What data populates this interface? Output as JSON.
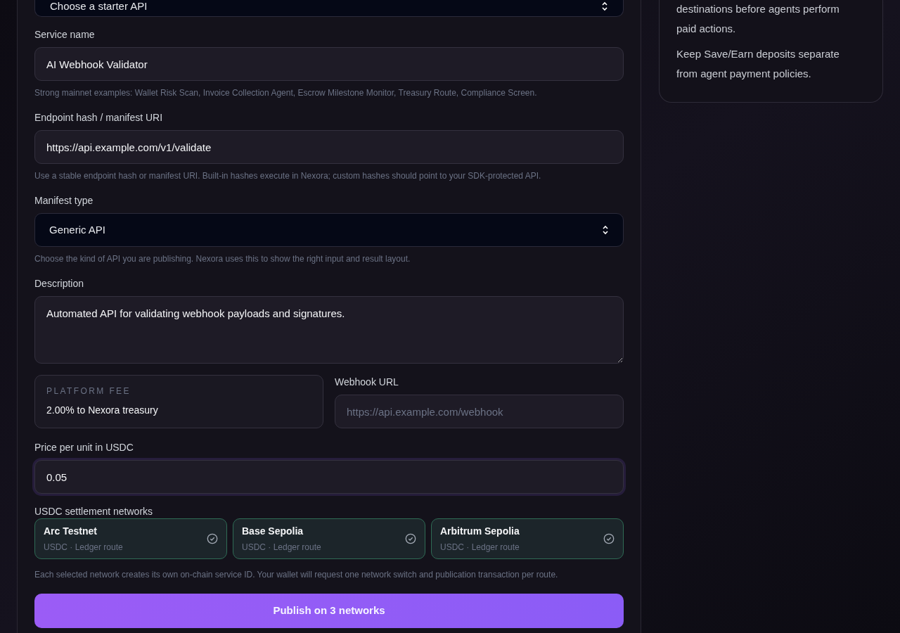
{
  "starter_select": {
    "value": "Choose a starter API"
  },
  "fields": [
    {
      "kind": "input",
      "label": "Service name",
      "value": "AI Webhook Validator",
      "hint": "Strong mainnet examples: Wallet Risk Scan, Invoice Collection Agent, Escrow Milestone Monitor, Treasury Route, Compliance Screen."
    },
    {
      "kind": "input",
      "label": "Endpoint hash / manifest URI",
      "value": "https://api.example.com/v1/validate",
      "hint": "Use a stable endpoint hash or manifest URI. Built-in hashes execute in Nexora; custom hashes should point to your SDK-protected API."
    },
    {
      "kind": "select",
      "label": "Manifest type",
      "value": "Generic API",
      "hint": "Choose the kind of API you are publishing. Nexora uses this to show the right input and result layout."
    },
    {
      "kind": "textarea",
      "label": "Description",
      "value": "Automated API for validating webhook payloads and signatures."
    }
  ],
  "platform_fee": {
    "label": "PLATFORM FEE",
    "value": "2.00% to Nexora treasury"
  },
  "webhook": {
    "label": "Webhook URL",
    "placeholder": "https://api.example.com/webhook"
  },
  "price": {
    "label": "Price per unit in USDC",
    "value": "0.05",
    "focused": true
  },
  "networks": {
    "label": "USDC settlement networks",
    "items": [
      {
        "name": "Arc Testnet",
        "detail": "USDC · Ledger route",
        "selected": true
      },
      {
        "name": "Base Sepolia",
        "detail": "USDC · Ledger route",
        "selected": true
      },
      {
        "name": "Arbitrum Sepolia",
        "detail": "USDC · Ledger route",
        "selected": true
      }
    ],
    "hint": "Each selected network creates its own on-chain service ID. Your wallet will request one network switch and publication transaction per route."
  },
  "publish_button": "Publish on 3 networks",
  "side_card": {
    "paragraphs": [
      "destinations before agents perform paid actions.",
      "Keep Save/Earn deposits separate from agent payment policies."
    ]
  }
}
